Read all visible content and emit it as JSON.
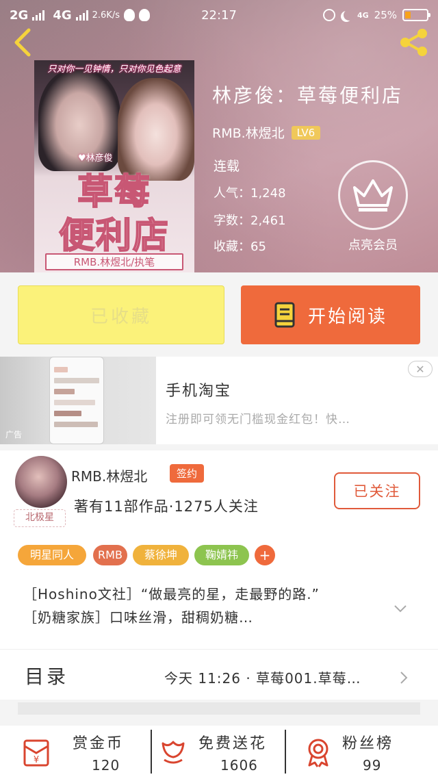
{
  "status_bar": {
    "network1": "2G",
    "network2": "4G",
    "speed": "2.6K/s",
    "time": "22:17",
    "net_small": "4G",
    "battery": "25%",
    "battery_level": 0.25,
    "battery_color": "#f7a21b"
  },
  "cover": {
    "tagline": "只对你一见钟情，只对你见色起意",
    "author_mark": "♥林彦俊",
    "title_line1": "草莓",
    "title_line2": "便利店",
    "subtitle": "RMB.林煜北/执笔"
  },
  "book": {
    "title": "林彦俊：草莓便利店",
    "author": "RMB.林煜北",
    "level": "LV6",
    "status": "连载",
    "popularity": "人气：1,248",
    "word_count": "字数：2,461",
    "favorites": "收藏：65",
    "vip_label": "点亮会员"
  },
  "actions": {
    "collected": "已收藏",
    "start_reading": "开始阅读"
  },
  "ad": {
    "title": "手机淘宝",
    "description": "注册即可领无门槛现金红包！快…",
    "mark": "广告",
    "close": "✕"
  },
  "author_card": {
    "name": "RMB.林煜北",
    "signed": "签约",
    "avatar_badge": "北极星",
    "works": "著有11部作品·1275人关注",
    "follow_state": "已关注",
    "tags": [
      {
        "label": "明星同人",
        "color": "#f5a63a"
      },
      {
        "label": "RMB",
        "color": "#e2704e"
      },
      {
        "label": "蔡徐坤",
        "color": "#f0b23c"
      },
      {
        "label": "鞠婧祎",
        "color": "#8dc44f"
      }
    ],
    "add_tag": "+",
    "intro_line1": "［Hoshino文社］“做最亮的星，走最野的路.”",
    "intro_line2": "［奶糖家族］口味丝滑，甜稠奶糖…"
  },
  "catalog": {
    "title": "目录",
    "latest": "今天 11:26 · 草莓001.草莓…"
  },
  "bottom_stats": [
    {
      "label": "赏金币",
      "value": "120",
      "icon": "red-envelope-icon"
    },
    {
      "label": "免费送花",
      "value": "1606",
      "icon": "flower-icon"
    },
    {
      "label": "粉丝榜",
      "value": "99",
      "icon": "medal-icon"
    }
  ],
  "colors": {
    "accent": "#ef6a3c",
    "collect_button": "#fbf27a",
    "icon_red": "#d9452f"
  }
}
